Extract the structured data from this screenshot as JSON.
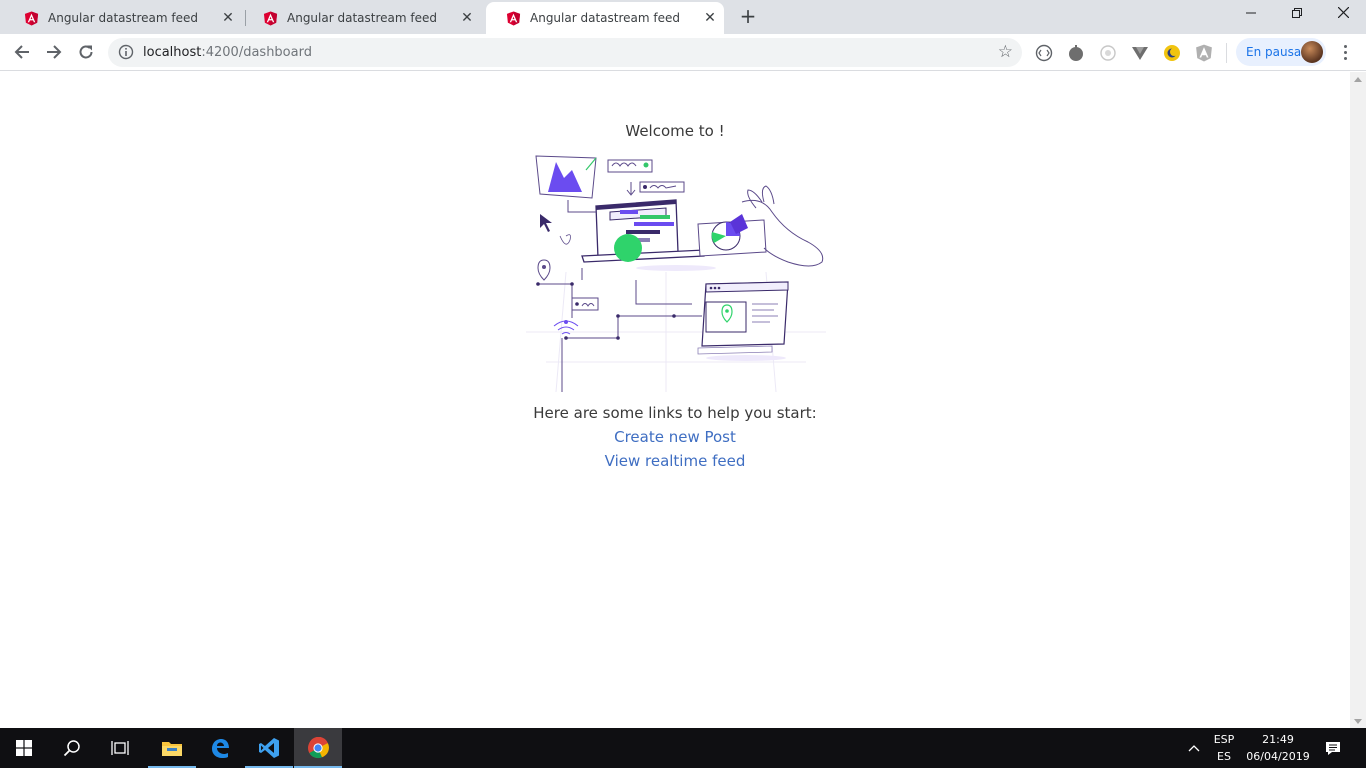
{
  "tabs": [
    {
      "title": "Angular datastream feed",
      "close": "✕"
    },
    {
      "title": "Angular datastream feed",
      "close": "✕"
    },
    {
      "title": "Angular datastream feed",
      "close": "✕"
    }
  ],
  "new_tab": "+",
  "window_controls": {
    "minimize": "—",
    "restore": "❐",
    "close": "✕"
  },
  "address_bar": {
    "host": "localhost",
    "rest": ":4200/dashboard"
  },
  "profile": {
    "label": "En pausa"
  },
  "page": {
    "welcome": "Welcome to !",
    "links_heading": "Here are some links to help you start:",
    "links": [
      {
        "label": "Create new Post"
      },
      {
        "label": "View realtime feed"
      }
    ]
  },
  "taskbar": {
    "language": "ESP",
    "layout": "ES",
    "time": "21:49",
    "date": "06/04/2019"
  },
  "icons": [
    "angular-icon",
    "back-arrow-icon",
    "forward-arrow-icon",
    "reload-icon",
    "info-icon",
    "star-icon",
    "windows-start-icon",
    "search-icon",
    "task-view-icon",
    "file-explorer-icon",
    "edge-icon",
    "vscode-icon",
    "chrome-icon",
    "tray-chevron-icon",
    "notification-icon"
  ],
  "colors": {
    "link": "#3f6ec2",
    "tab_strip": "#dee1e6",
    "taskbar": "#0f0f12",
    "angular": "#dd0031",
    "profile_text": "#1a73e8"
  }
}
